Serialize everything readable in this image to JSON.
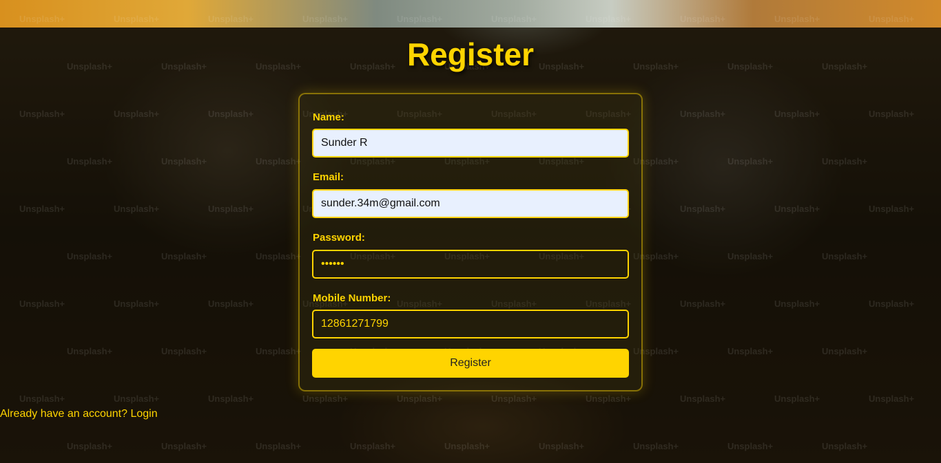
{
  "page": {
    "title": "Register"
  },
  "form": {
    "name_label": "Name:",
    "name_value": "Sunder R",
    "email_label": "Email:",
    "email_value": "sunder.34m@gmail.com",
    "password_label": "Password:",
    "password_value": "••••••",
    "mobile_label": "Mobile Number:",
    "mobile_value": "12861271799",
    "submit_label": "Register"
  },
  "footer": {
    "prompt": "Already have an account?",
    "login_link": "Login"
  },
  "background": {
    "watermark_text": "Unsplash+"
  },
  "colors": {
    "accent": "#ffd400",
    "input_fill": "#e8f0fe"
  }
}
